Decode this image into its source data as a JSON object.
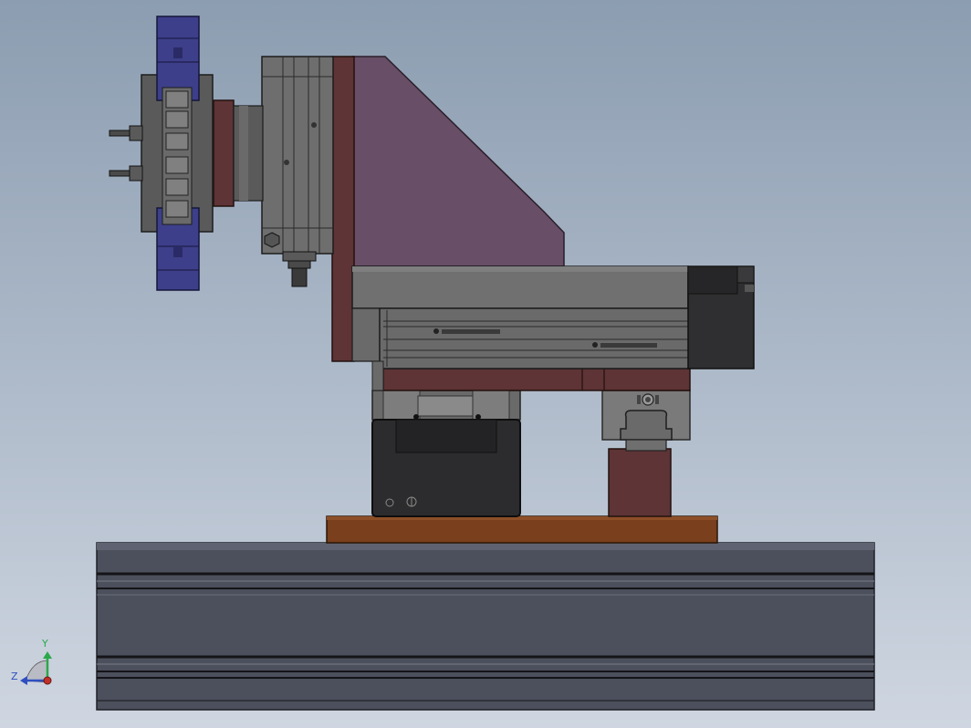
{
  "viewport": {
    "background_top": "#8c9db1",
    "background_bottom": "#cfd6e1"
  },
  "triad": {
    "y_label": "Y",
    "z_label": "Z",
    "y_color": "#2aa84a",
    "z_color": "#2f4fbf",
    "x_color": "#c0302a"
  },
  "model": {
    "base_rail": "aluminum-profile-rail",
    "mount_plate": "mount-plate",
    "servo_motor": "servo-motor",
    "linear_slide": "linear-slide",
    "gripper_wheel": "gripper-wheel"
  },
  "colors": {
    "rail": "#4c4f5c",
    "plate": "#7a3f1c",
    "brown": "#5e3436",
    "purple": "#684e66",
    "gray": "#707070",
    "dark": "#2c2c2e",
    "blue": "#3d3f8a"
  }
}
